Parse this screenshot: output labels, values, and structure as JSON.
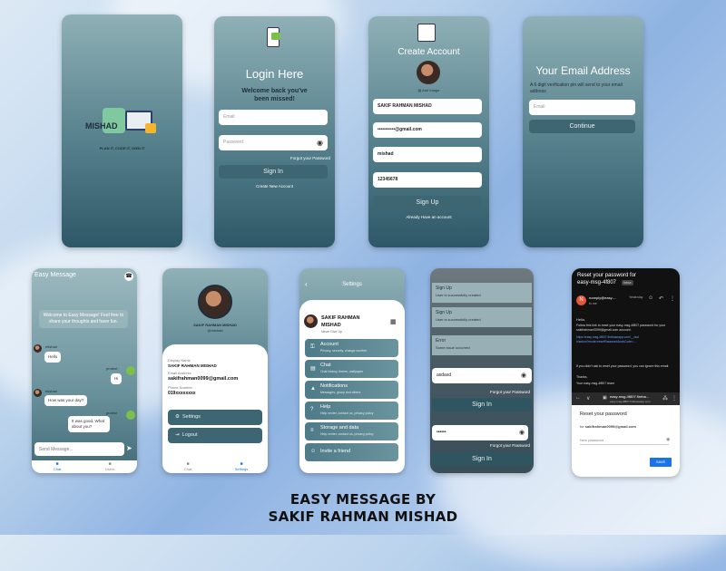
{
  "caption": {
    "line1": "EASY MESSAGE BY",
    "line2": "SAKIF RAHMAN MISHAD"
  },
  "splash": {
    "logo_text": "MISHAD",
    "tagline": "PLAN IT, CODE IT, OWN IT"
  },
  "login": {
    "title": "Login Here",
    "subtitle": "Welcome back you've been missed!",
    "email_placeholder": "Email",
    "password_placeholder": "Password",
    "forgot": "Forgot your Password",
    "sign_in": "Sign In",
    "create": "Create New Account"
  },
  "create_account": {
    "title": "Create Account",
    "add_image": "Add Image",
    "name_value": "SAKIF RAHMAN MISHAD",
    "email_value": "•••••••••••@gmail.com",
    "username_value": "mishad",
    "password_value": "12345678",
    "sign_up": "Sign Up",
    "have_account": "Already Have an account"
  },
  "email_verify": {
    "title": "Your Email Address",
    "description": "A 6 digit verification pin will send to your email address",
    "email_placeholder": "Email",
    "continue": "Continue"
  },
  "chat": {
    "title": "Easy Message",
    "welcome": "Welcome to Easy Message! Feel free to share your thoughts and have fun.",
    "messages": [
      {
        "sender": "mishad",
        "text": "Hello",
        "side": "left"
      },
      {
        "sender": "protest",
        "text": "Hi",
        "side": "right"
      },
      {
        "sender": "mishad",
        "text": "How was your day?",
        "side": "left"
      },
      {
        "sender": "protest",
        "text": "It was good. What about you?",
        "side": "right"
      }
    ],
    "input_placeholder": "Send Message...",
    "nav": [
      "Chat",
      "Users"
    ]
  },
  "profile": {
    "name": "SAKIF RAHMAN MISHAD",
    "handle": "@mishad",
    "display_name_label": "Display Name",
    "display_name": "SAKIF RAHMAN MISHAD",
    "email_label": "Email Address",
    "email": "sakifrahman0099@gmail.com",
    "phone_label": "Phone Number",
    "phone": "019xxxxxxxx",
    "settings": "Settings",
    "logout": "Logout",
    "nav": [
      "Chat",
      "Settings"
    ]
  },
  "settings": {
    "title": "Settings",
    "name": "SAKIF RAHMAN MISHAD",
    "status": "Never Give Up",
    "items": [
      {
        "label": "Account",
        "sub": "Privacy, security, change number"
      },
      {
        "label": "Chat",
        "sub": "Chat history, theme, wallpaper"
      },
      {
        "label": "Notifications",
        "sub": "Messages, group and others"
      },
      {
        "label": "Help",
        "sub": "Help center, contact us, privacy policy"
      },
      {
        "label": "Storage and data",
        "sub": "Help center, contact us, privacy policy"
      },
      {
        "label": "Invite a friend",
        "sub": ""
      }
    ]
  },
  "reset_flow": {
    "toasts": [
      {
        "title": "Sign Up",
        "sub": "User is successfully created"
      },
      {
        "title": "Sign Up",
        "sub": "User is successfully created"
      },
      {
        "title": "Error",
        "sub": "Some issue occurred"
      }
    ],
    "field_value": "asdasd",
    "forgot": "Forgot your Password",
    "sign_in": "Sign In",
    "password_dots": "••••••",
    "forgot2": "Forgot your Password",
    "sign_in2": "Sign In"
  },
  "email_app": {
    "subject": "Reset your password for easy-msg-4f807",
    "inbox_tag": "Inbox",
    "sender_name": "noreply@easy-...",
    "sender_date": "Yesterday",
    "to_me": "to me",
    "hello": "Hello,",
    "body1": "Follow this link to reset your easy-msg-4f807 password for your sakifrahman0099@gmail.com account.",
    "link": "https://easy-msg-4f807.firebaseapp.com/__/auth/action?mode=resetPassword&oobCode=...",
    "body2": "If you didn't ask to reset your password, you can ignore this email.",
    "thanks": "Thanks,",
    "team": "Your easy-msg-4f807 team",
    "browser_title": "easy-msg-4f807.fireba...",
    "browser_url": "easy-msg-4f807.firebaseapp.com",
    "reset_title": "Reset your password",
    "reset_for_prefix": "for",
    "reset_for_email": "sakifrahman0099@gmail.com",
    "new_password_placeholder": "New password",
    "save": "SAVE"
  },
  "colors": {
    "phone_top": "#8fb0b6",
    "phone_bottom": "#2e5867",
    "button": "#3d6672",
    "accent_blue": "#1a73e8"
  }
}
